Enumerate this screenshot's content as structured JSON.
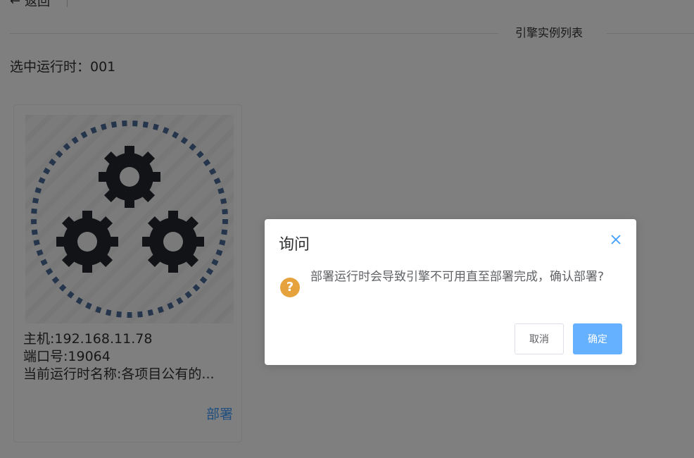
{
  "header": {
    "back_icon": "arrow-left-icon",
    "back_label": "返回"
  },
  "section": {
    "title": "引擎实例列表"
  },
  "selected_runtime": "选中运行时：001",
  "engine_card": {
    "image_icon": "gears-icon",
    "host": "主机:192.168.11.78",
    "port": "端口号:19064",
    "runtime_name": "当前运行时名称:各项目公有的...",
    "deploy_label": "部署"
  },
  "dialog": {
    "title": "询问",
    "close_icon": "close-icon",
    "status_icon": "question-circle-icon",
    "status_glyph": "?",
    "message": "部署运行时会导致引擎不可用直至部署完成，确认部署?",
    "cancel_label": "取消",
    "confirm_label": "确定"
  },
  "colors": {
    "primary": "#409eff",
    "confirm_button": "#66b1ff",
    "warning": "#e6a23c",
    "overlay": "rgba(0,0,0,0.5)",
    "gear": "#23272e",
    "ring": "#4a6a96"
  }
}
